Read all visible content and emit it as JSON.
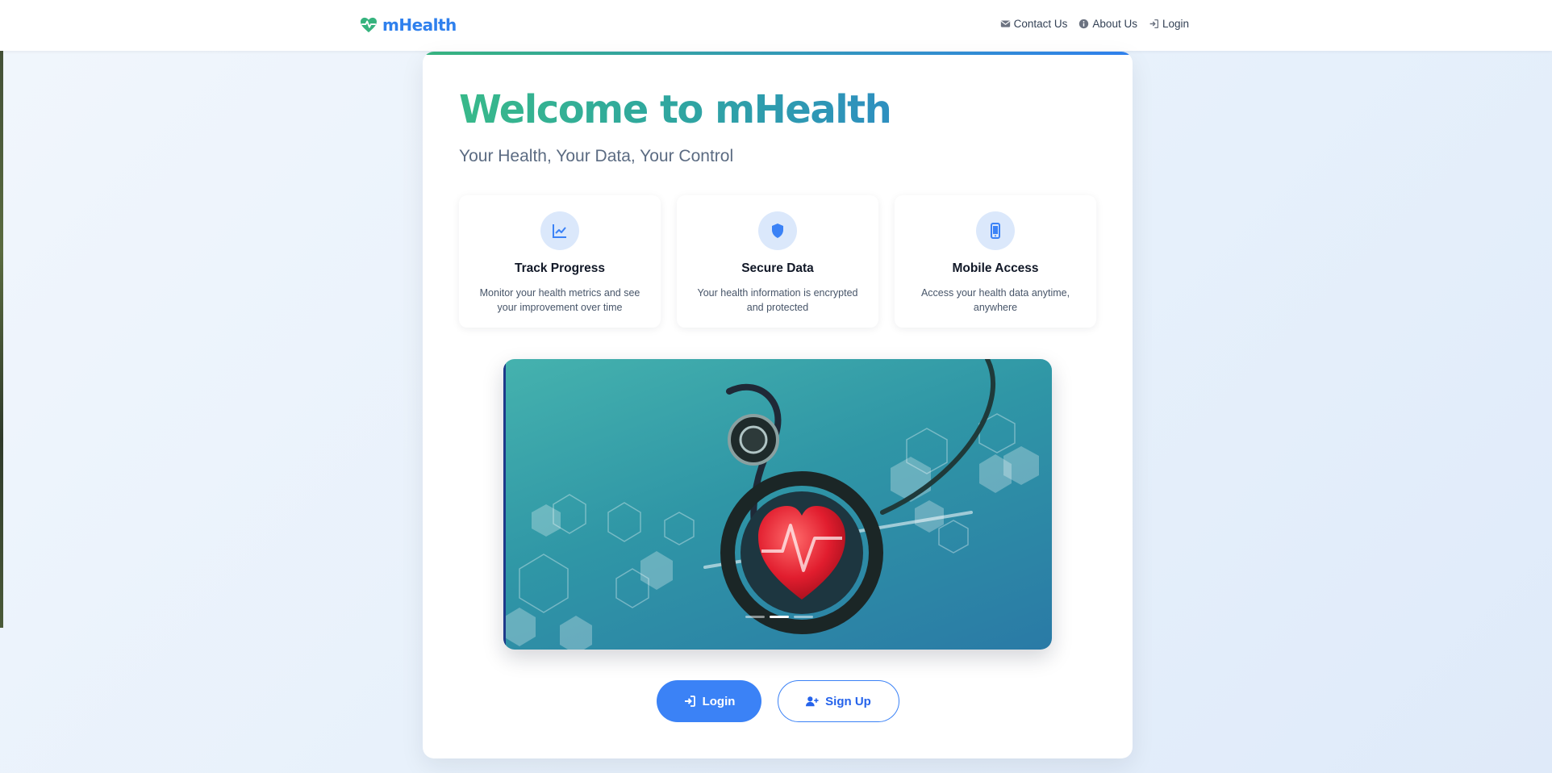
{
  "brand": {
    "name": "mHealth",
    "logo_icon": "heart-pulse-icon",
    "color": "#2f80ed"
  },
  "nav": {
    "links": [
      {
        "label": "Contact Us",
        "icon": "envelope-icon"
      },
      {
        "label": "About Us",
        "icon": "info-circle-icon"
      },
      {
        "label": "Login",
        "icon": "sign-in-icon"
      }
    ]
  },
  "hero": {
    "title": "Welcome to mHealth",
    "subtitle": "Your Health, Your Data, Your Control"
  },
  "features": [
    {
      "icon": "chart-line-icon",
      "title": "Track Progress",
      "description": "Monitor your health metrics and see your improvement over time"
    },
    {
      "icon": "shield-icon",
      "title": "Secure Data",
      "description": "Your health information is encrypted and protected"
    },
    {
      "icon": "mobile-icon",
      "title": "Mobile Access",
      "description": "Access your health data anytime, anywhere"
    }
  ],
  "carousel": {
    "slide_count": 3,
    "active_index": 1
  },
  "actions": {
    "login_label": "Login",
    "signup_label": "Sign Up"
  },
  "colors": {
    "accent": "#3b82f6",
    "title_gradient_start": "#38b98a",
    "title_gradient_end": "#2e8fc0"
  }
}
